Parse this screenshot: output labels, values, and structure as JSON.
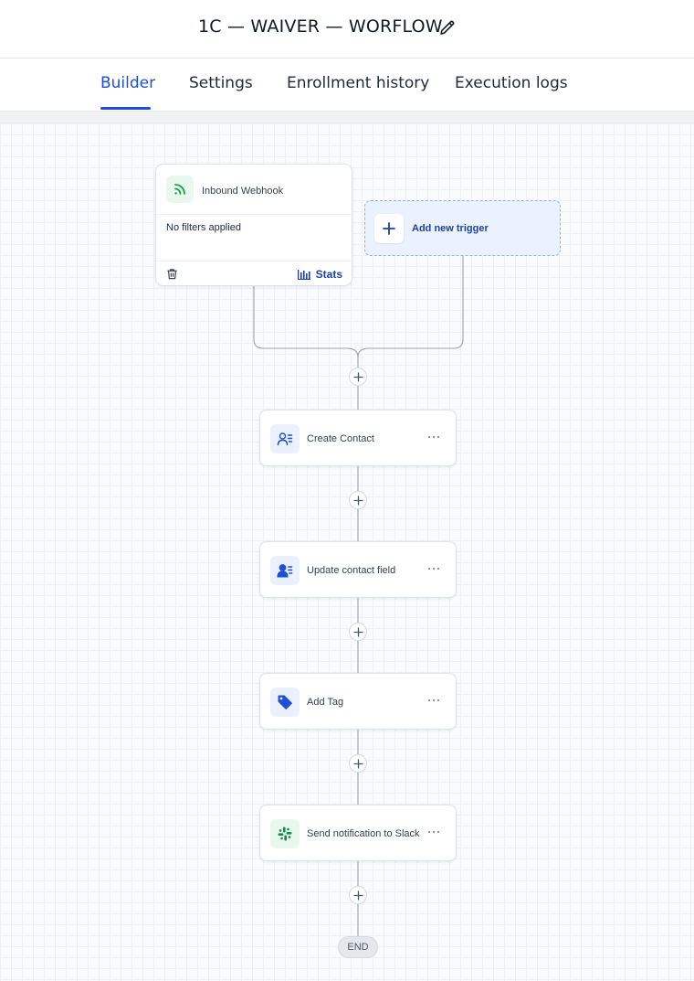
{
  "workflow": {
    "title": "1C — WAIVER — WORFLOW"
  },
  "tabs": [
    {
      "label": "Builder",
      "active": true
    },
    {
      "label": "Settings",
      "active": false
    },
    {
      "label": "Enrollment history",
      "active": false
    },
    {
      "label": "Execution logs",
      "active": false
    }
  ],
  "trigger": {
    "name": "Inbound Webhook",
    "icon": "rss-icon",
    "filter_text": "No filters applied",
    "stats_label": "Stats"
  },
  "add_trigger": {
    "label": "Add new trigger"
  },
  "actions": [
    {
      "label": "Create Contact",
      "icon": "contact-list-icon"
    },
    {
      "label": "Update contact field",
      "icon": "contact-edit-icon"
    },
    {
      "label": "Add Tag",
      "icon": "tag-icon"
    },
    {
      "label": "Send notification to Slack",
      "icon": "slack-icon"
    }
  ],
  "end_label": "END",
  "colors": {
    "accent": "#1d4ed8",
    "action_icon_blue": "#1e50d6",
    "trigger_icon_green": "#15a34a"
  }
}
